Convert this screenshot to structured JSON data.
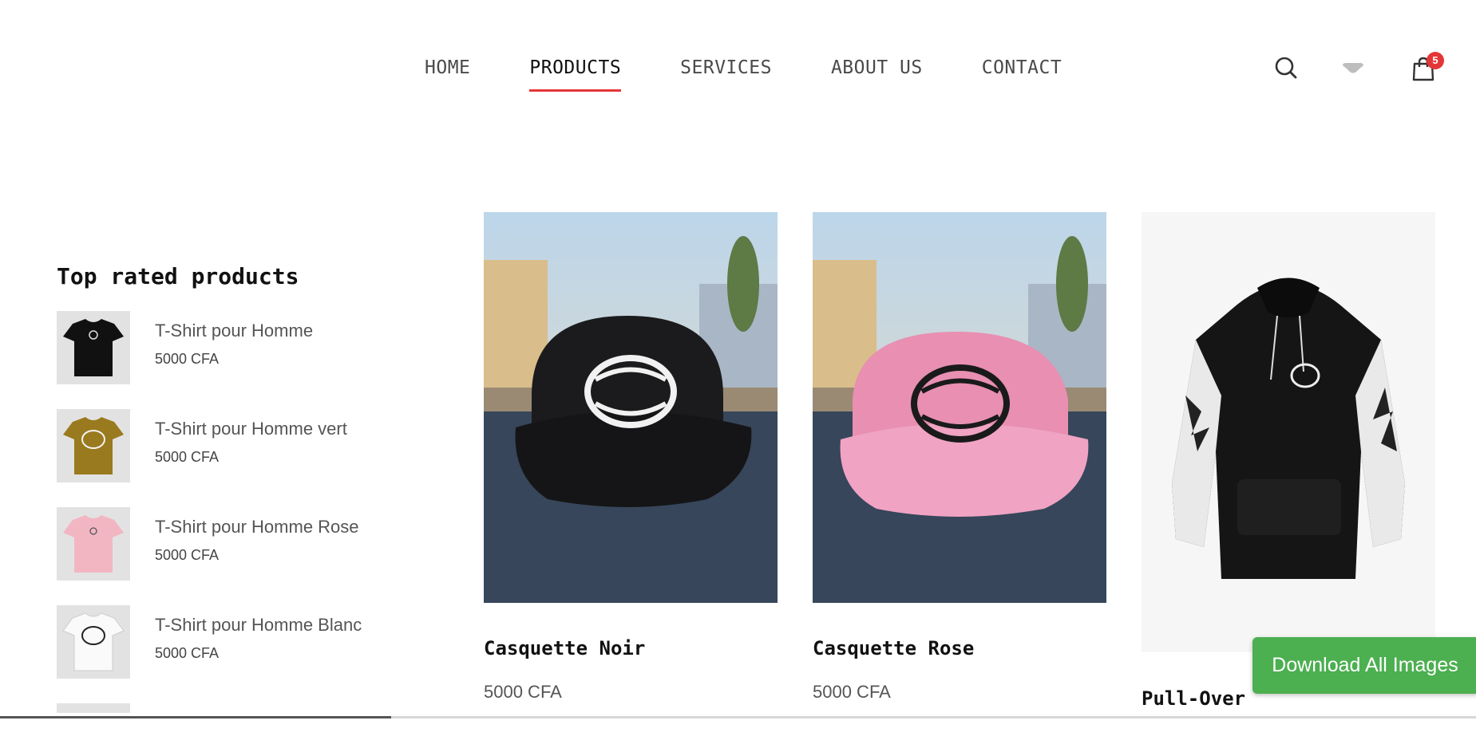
{
  "nav": {
    "items": [
      {
        "label": "HOME",
        "active": false
      },
      {
        "label": "PRODUCTS",
        "active": true
      },
      {
        "label": "SERVICES",
        "active": false
      },
      {
        "label": "ABOUT US",
        "active": false
      },
      {
        "label": "CONTACT",
        "active": false
      }
    ],
    "accent_color": "#e53637"
  },
  "header_icons": {
    "search": "search-icon",
    "wishlist": "heart-icon",
    "cart": "shopping-bag-icon",
    "cart_count": "5"
  },
  "sidebar": {
    "title": "Top rated products",
    "items": [
      {
        "name": "T-Shirt pour Homme",
        "price": "5000 CFA",
        "color": "#111111"
      },
      {
        "name": "T-Shirt pour Homme vert",
        "price": "5000 CFA",
        "color": "#9a7a1e"
      },
      {
        "name": "T-Shirt pour Homme Rose",
        "price": "5000 CFA",
        "color": "#f2b6c2"
      },
      {
        "name": "T-Shirt pour Homme Blanc",
        "price": "5000 CFA",
        "color": "#fafafa"
      }
    ]
  },
  "products": [
    {
      "name": "Casquette Noir",
      "price": "5000 CFA",
      "color": "#1c1c1e"
    },
    {
      "name": "Casquette Rose",
      "price": "5000 CFA",
      "color": "#ee9ab8"
    },
    {
      "name": "Pull-Over",
      "price": "",
      "color": "#111111"
    }
  ],
  "download_button": {
    "label": "Download All Images",
    "color": "#4caf50"
  }
}
